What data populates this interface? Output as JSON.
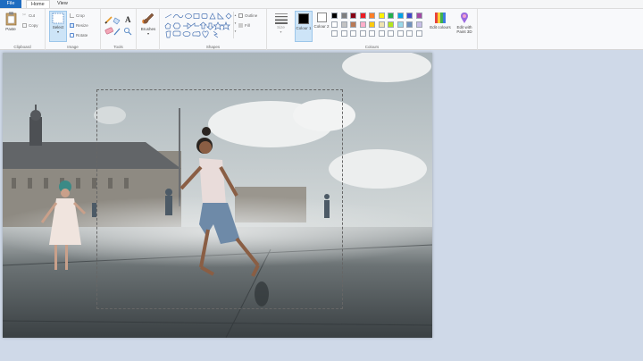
{
  "menu": {
    "file": "File",
    "home": "Home",
    "view": "View"
  },
  "clipboard": {
    "paste": "Paste",
    "cut": "Cut",
    "copy": "Copy",
    "label": "Clipboard"
  },
  "image": {
    "select": "Select",
    "crop": "Crop",
    "resize": "Resize",
    "rotate": "Rotate",
    "label": "Image"
  },
  "tools": {
    "label": "Tools",
    "text_glyph": "A"
  },
  "brushes": {
    "label": "Brushes"
  },
  "shapes": {
    "outline": "Outline",
    "fill": "Fill",
    "label": "Shapes"
  },
  "size": {
    "label": "Size"
  },
  "colours": {
    "colour1": "Colour 1",
    "colour2": "Colour 2",
    "edit": "Edit colours",
    "paint3d": "Edit with Paint 3D",
    "label": "Colours",
    "row1": [
      "#000000",
      "#7f7f7f",
      "#880015",
      "#ed1c24",
      "#ff7f27",
      "#fff200",
      "#22b14c",
      "#00a2e8",
      "#3f48cc",
      "#a349a4"
    ],
    "row2": [
      "#ffffff",
      "#c3c3c3",
      "#b97a57",
      "#ffaec9",
      "#ffc90e",
      "#efe4b0",
      "#b5e61d",
      "#99d9ea",
      "#7092be",
      "#c8bfe7"
    ],
    "row3": [
      "#ffffff",
      "#ffffff",
      "#ffffff",
      "#ffffff",
      "#ffffff",
      "#ffffff",
      "#ffffff",
      "#ffffff",
      "#ffffff",
      "#ffffff"
    ]
  }
}
